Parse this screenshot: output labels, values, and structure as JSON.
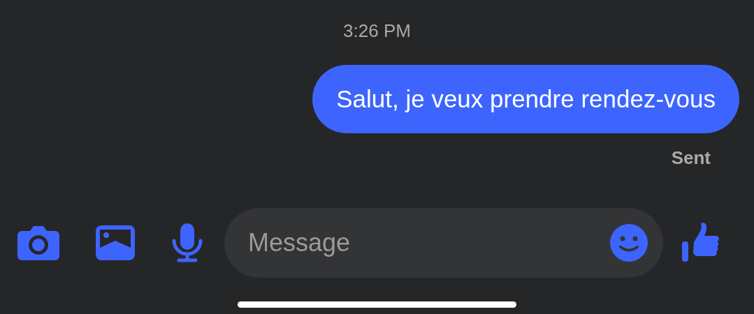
{
  "timestamp": "3:26 PM",
  "messages": [
    {
      "text": "Salut, je veux prendre rendez-vous",
      "outgoing": true
    }
  ],
  "status": "Sent",
  "composer": {
    "placeholder": "Message"
  }
}
